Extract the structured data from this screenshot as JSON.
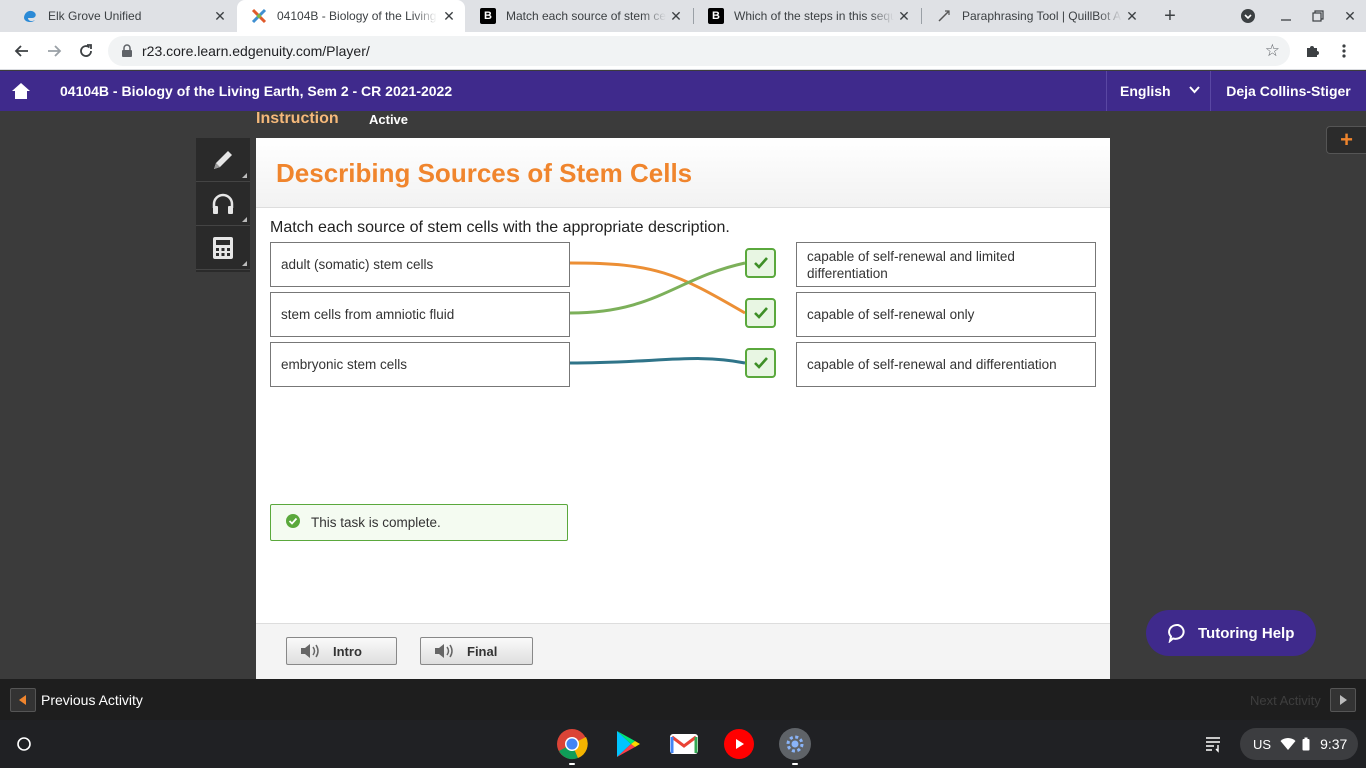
{
  "browser": {
    "tabs": [
      {
        "title": "Elk Grove Unified",
        "favicon": "edge-icon",
        "active": false
      },
      {
        "title": "04104B - Biology of the Living",
        "favicon": "edgenuity-icon",
        "active": true
      },
      {
        "title": "Match each source of stem cel",
        "favicon": "brainly-icon",
        "active": false
      },
      {
        "title": "Which of the steps in this sequ",
        "favicon": "brainly-icon",
        "active": false
      },
      {
        "title": "Paraphrasing Tool | QuillBot A",
        "favicon": "quillbot-icon",
        "active": false
      }
    ],
    "url": "r23.core.learn.edgenuity.com/Player/"
  },
  "header": {
    "course_title": "04104B - Biology of the Living Earth, Sem 2 - CR 2021-2022",
    "language": "English",
    "user_name": "Deja Collins-Stiger"
  },
  "lesson": {
    "section": "Instruction",
    "status": "Active",
    "title": "Describing Sources of Stem Cells",
    "prompt": "Match each source of stem cells with the appropriate description.",
    "sources": [
      "adult (somatic) stem cells",
      "stem cells from amniotic fluid",
      "embryonic stem cells"
    ],
    "descriptions": [
      "capable of self-renewal and limited differentiation",
      "capable of self-renewal only",
      "capable of self-renewal and differentiation"
    ],
    "matches": [
      {
        "source": "adult (somatic) stem cells",
        "description": "capable of self-renewal only",
        "color": "#ec8f35",
        "correct": true
      },
      {
        "source": "stem cells from amniotic fluid",
        "description": "capable of self-renewal and limited differentiation",
        "color": "#7cb05a",
        "correct": true
      },
      {
        "source": "embryonic stem cells",
        "description": "capable of self-renewal and differentiation",
        "color": "#2f7489",
        "correct": true
      }
    ],
    "complete_message": "This task is complete.",
    "footer_buttons": {
      "intro": "Intro",
      "final": "Final"
    }
  },
  "tutoring_label": "Tutoring Help",
  "nav": {
    "previous": "Previous Activity",
    "next": "Next Activity"
  },
  "system_tray": {
    "ime": "US",
    "time": "9:37"
  },
  "colors": {
    "brand_purple": "#3f2a8c",
    "title_orange": "#f0852d",
    "success_green": "#5aa83c"
  }
}
